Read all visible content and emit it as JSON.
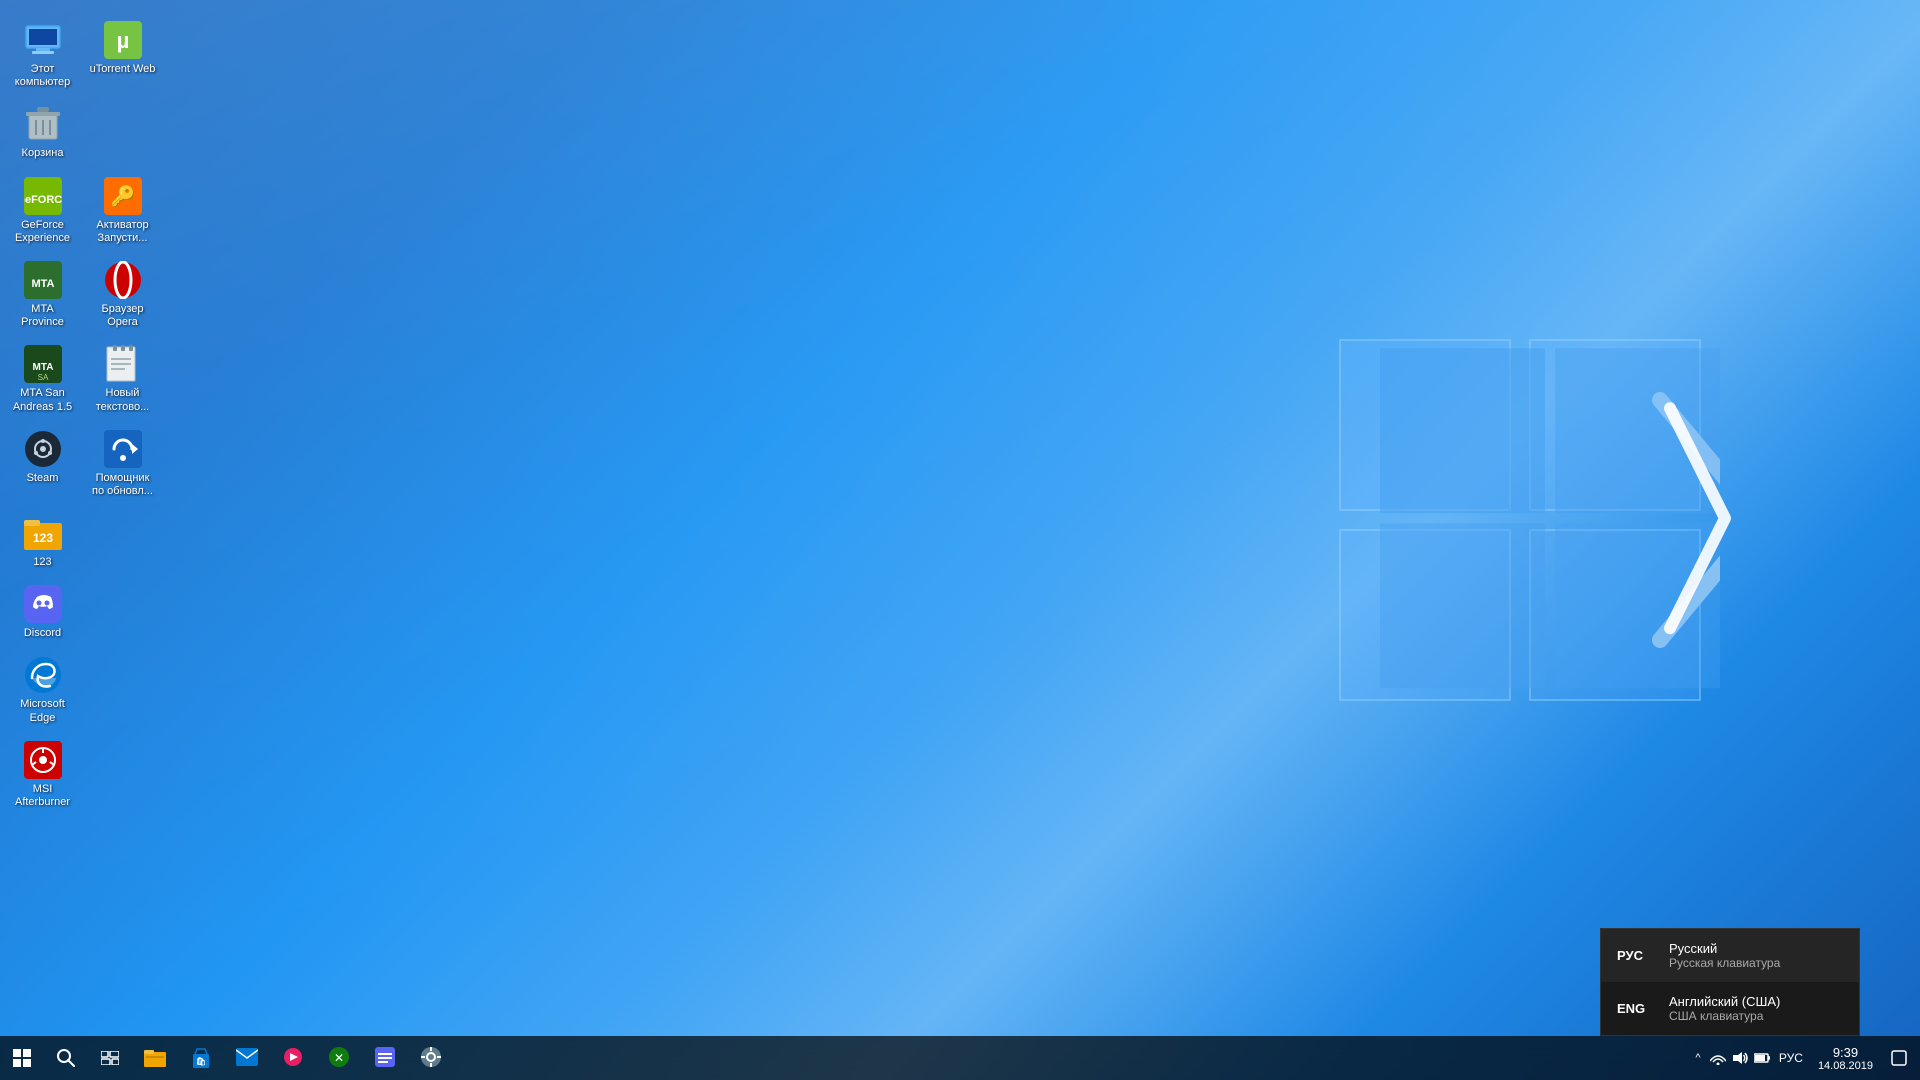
{
  "desktop": {
    "background_color": "#1565c0"
  },
  "icons": [
    {
      "id": "this-pc",
      "label": "Этот\nкомпьютер",
      "col": 0,
      "row": 0,
      "icon_type": "monitor",
      "color": "#64b5f6"
    },
    {
      "id": "utorrent",
      "label": "uTorrent Web",
      "col": 1,
      "row": 0,
      "icon_type": "utorrent",
      "color": "#76c442"
    },
    {
      "id": "trash",
      "label": "Корзина",
      "col": 0,
      "row": 1,
      "icon_type": "trash",
      "color": "#ccc"
    },
    {
      "id": "geforce",
      "label": "GeForce\nExperience",
      "col": 0,
      "row": 2,
      "icon_type": "nvidia",
      "color": "#76b900"
    },
    {
      "id": "activator",
      "label": "Активатор\nЗапусти...",
      "col": 1,
      "row": 2,
      "icon_type": "activator",
      "color": "#ff6d00"
    },
    {
      "id": "mta-province",
      "label": "MTA\nProvince",
      "col": 0,
      "row": 3,
      "icon_type": "mta",
      "color": "#2c5f2e"
    },
    {
      "id": "opera",
      "label": "Браузер\nOpera",
      "col": 1,
      "row": 3,
      "icon_type": "opera",
      "color": "#cc0000"
    },
    {
      "id": "mta-sa",
      "label": "MTA San\nAndreas 1.5",
      "col": 0,
      "row": 4,
      "icon_type": "mta2",
      "color": "#2c5f2e"
    },
    {
      "id": "notepad",
      "label": "Новый\nтекстово...",
      "col": 1,
      "row": 4,
      "icon_type": "notepad",
      "color": "#fff"
    },
    {
      "id": "steam",
      "label": "Steam",
      "col": 0,
      "row": 5,
      "icon_type": "steam",
      "color": "#1b2838"
    },
    {
      "id": "update-helper",
      "label": "Помощник\nпо обновл...",
      "col": 1,
      "row": 5,
      "icon_type": "update",
      "color": "#1976d2"
    },
    {
      "id": "123",
      "label": "123",
      "col": 0,
      "row": 6,
      "icon_type": "folder",
      "color": "#f0a500"
    },
    {
      "id": "discord",
      "label": "Discord",
      "col": 0,
      "row": 7,
      "icon_type": "discord",
      "color": "#5865f2"
    },
    {
      "id": "edge",
      "label": "Microsoft\nEdge",
      "col": 0,
      "row": 8,
      "icon_type": "edge",
      "color": "#0078d4"
    },
    {
      "id": "msi-afterburner",
      "label": "MSI\nAfterburner",
      "col": 0,
      "row": 9,
      "icon_type": "msi",
      "color": "#cc0000"
    }
  ],
  "taskbar": {
    "apps": [
      {
        "id": "start",
        "icon": "⊞",
        "label": "Start"
      },
      {
        "id": "search",
        "icon": "🔍",
        "label": "Search"
      },
      {
        "id": "task-view",
        "icon": "⧉",
        "label": "Task View"
      },
      {
        "id": "file-explorer",
        "icon": "📁",
        "label": "File Explorer"
      },
      {
        "id": "store",
        "icon": "🛍",
        "label": "Microsoft Store"
      },
      {
        "id": "mail",
        "icon": "✉",
        "label": "Mail"
      },
      {
        "id": "media-player",
        "icon": "▶",
        "label": "Media Player"
      },
      {
        "id": "xbox",
        "icon": "🎮",
        "label": "Xbox"
      },
      {
        "id": "app8",
        "icon": "≡",
        "label": "App"
      },
      {
        "id": "app9",
        "icon": "🔧",
        "label": "Tools"
      }
    ],
    "tray": {
      "expand_label": "^",
      "icons": [
        "🔔",
        "📶",
        "🔊",
        "⚡"
      ],
      "lang": "РУС",
      "time": "9:39",
      "date": "14.08.2019"
    }
  },
  "lang_popup": {
    "visible": true,
    "options": [
      {
        "code": "РУС",
        "name": "Русский",
        "sub": "Русская клавиатура",
        "active": true
      },
      {
        "code": "ENG",
        "name": "Английский (США)",
        "sub": "США клавиатура",
        "active": false
      }
    ]
  }
}
